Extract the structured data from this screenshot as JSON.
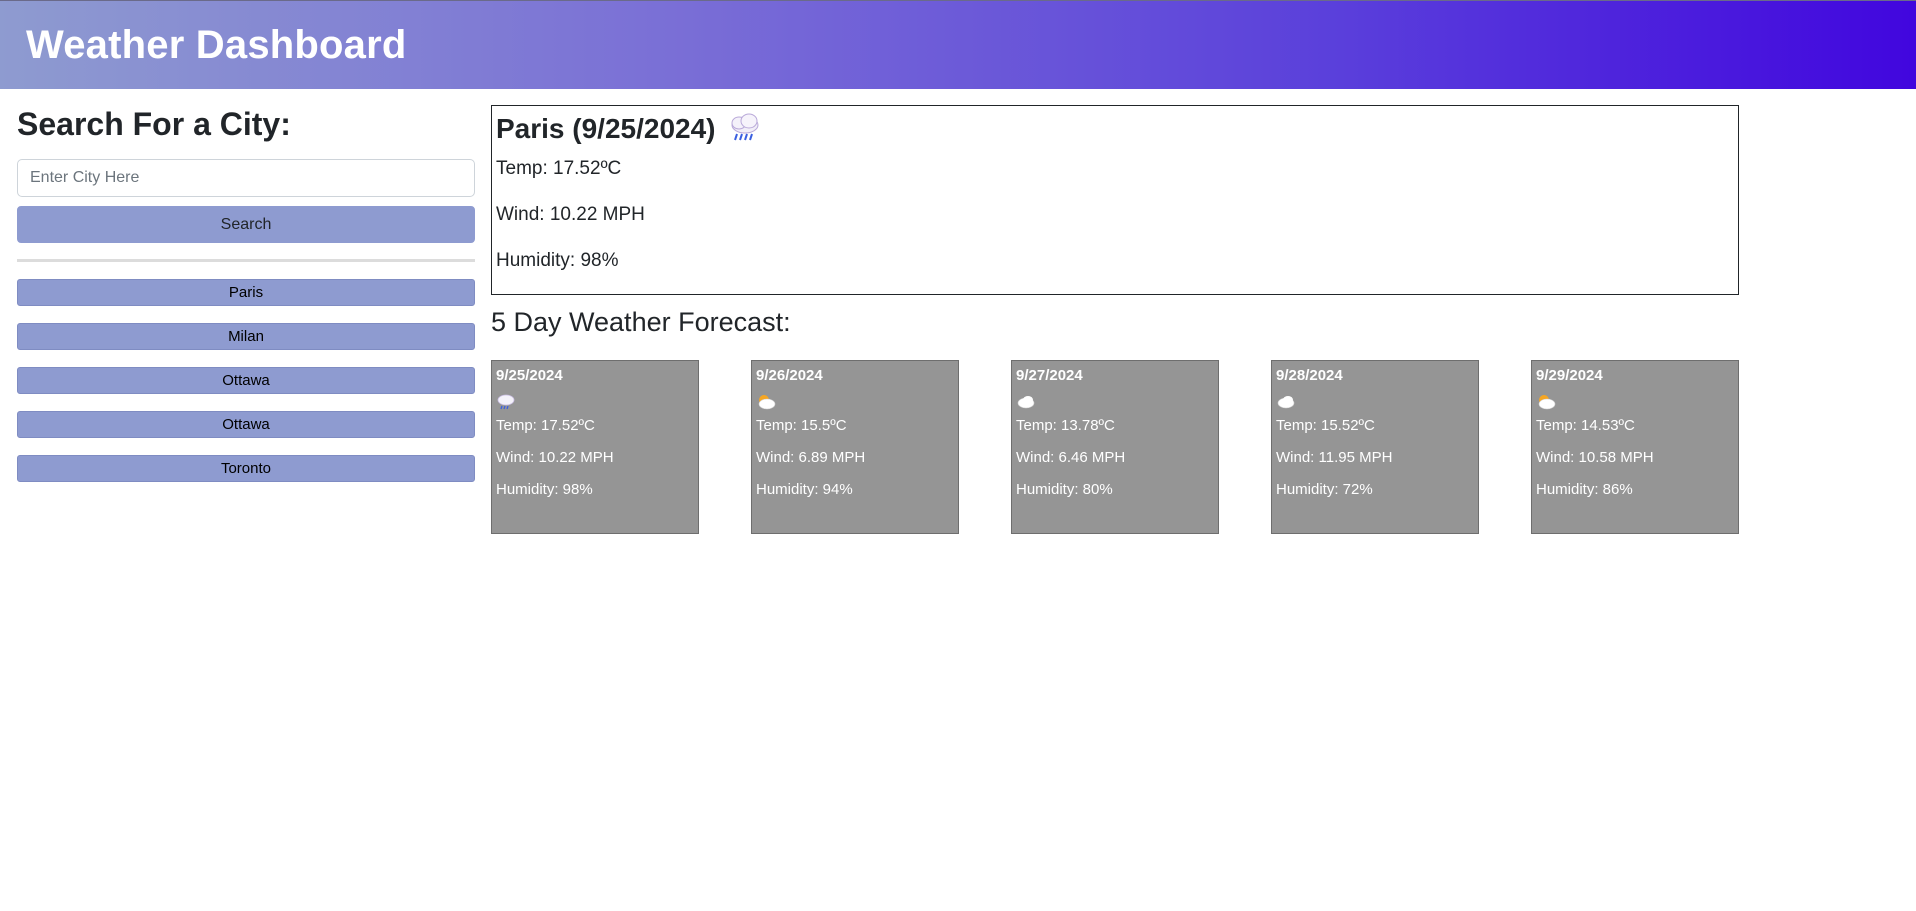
{
  "header": {
    "title": "Weather Dashboard"
  },
  "sidebar": {
    "heading": "Search For a City:",
    "search_placeholder": "Enter City Here",
    "search_value": "",
    "search_label": "Search",
    "history": [
      "Paris",
      "Milan",
      "Ottawa",
      "Ottawa",
      "Toronto"
    ]
  },
  "current": {
    "title": "Paris (9/25/2024)",
    "icon": "rain-cloud-icon",
    "temp": "Temp: 17.52ºC",
    "wind": "Wind: 10.22 MPH",
    "humidity": "Humidity: 98%"
  },
  "forecast": {
    "heading": "5 Day Weather Forecast:",
    "days": [
      {
        "date": "9/25/2024",
        "icon": "rain-cloud-icon",
        "temp": "Temp: 17.52ºC",
        "wind": "Wind: 10.22 MPH",
        "humidity": "Humidity: 98%"
      },
      {
        "date": "9/26/2024",
        "icon": "partly-cloudy-icon",
        "temp": "Temp: 15.5ºC",
        "wind": "Wind: 6.89 MPH",
        "humidity": "Humidity: 94%"
      },
      {
        "date": "9/27/2024",
        "icon": "cloud-icon",
        "temp": "Temp: 13.78ºC",
        "wind": "Wind: 6.46 MPH",
        "humidity": "Humidity: 80%"
      },
      {
        "date": "9/28/2024",
        "icon": "cloud-icon",
        "temp": "Temp: 15.52ºC",
        "wind": "Wind: 11.95 MPH",
        "humidity": "Humidity: 72%"
      },
      {
        "date": "9/29/2024",
        "icon": "partly-cloudy-icon",
        "temp": "Temp: 14.53ºC",
        "wind": "Wind: 10.58 MPH",
        "humidity": "Humidity: 86%"
      }
    ]
  },
  "colors": {
    "header_gradient_start": "#8e9bd0",
    "header_gradient_end": "#4106de",
    "button_bg": "#8e9bd0",
    "forecast_card_bg": "#959595"
  }
}
